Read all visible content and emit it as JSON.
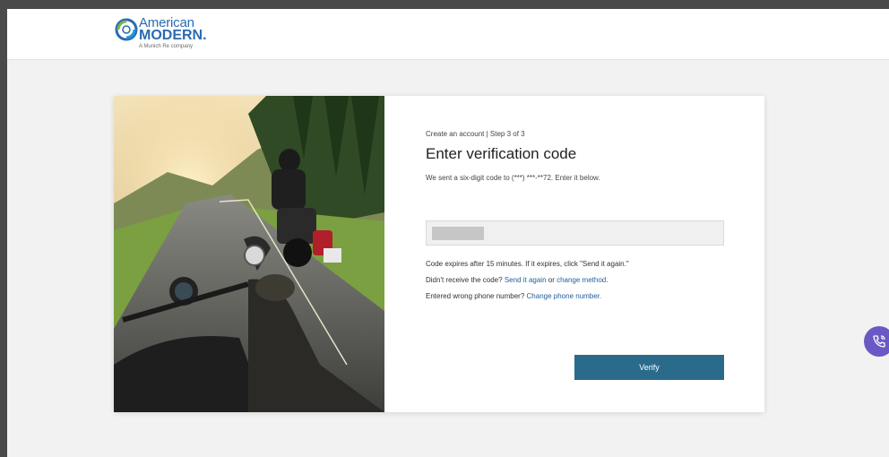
{
  "brand": {
    "line1": "American",
    "line2": "MODERN.",
    "tagline": "A Munich Re company"
  },
  "form": {
    "step": "Create an account | Step 3 of 3",
    "title": "Enter verification code",
    "subtitle": "We sent a six-digit code to (***) ***-**72. Enter it below.",
    "code_value": "",
    "expires": "Code expires after 15 minutes. If it expires, click \"Send it again.\"",
    "not_received_prefix": "Didn't receive the code? ",
    "send_again": "Send it again",
    "or": " or ",
    "change_method": "change method",
    "period": ".",
    "wrong_number_prefix": "Entered wrong phone number? ",
    "change_phone": "Change phone number.",
    "verify_label": "Verify"
  },
  "colors": {
    "accent": "#2a6b8c",
    "link": "#1f5f9e",
    "brand_blue": "#2a6bb3",
    "chat_fab": "#6a59c4"
  },
  "icons": {
    "chat": "phone-chat-icon"
  }
}
